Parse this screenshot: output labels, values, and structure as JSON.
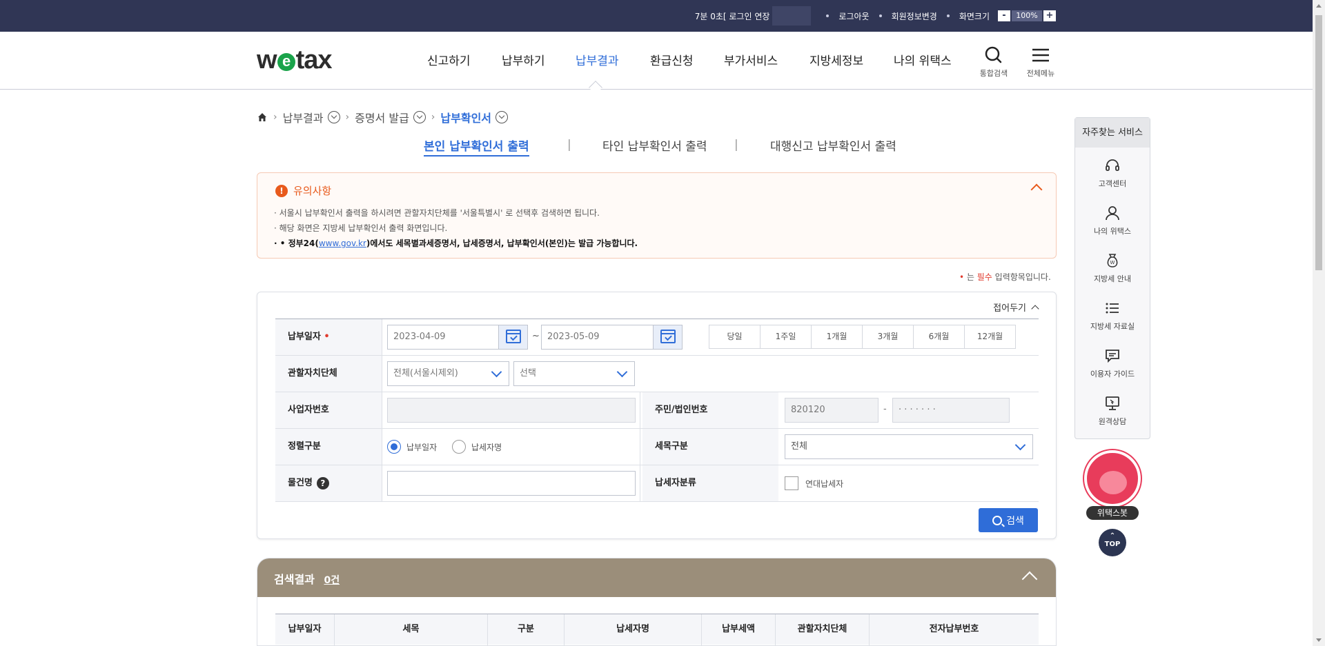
{
  "topbar": {
    "session_text": "7분 0초[ 로그인 연장",
    "logout": "로그아웃",
    "member_edit": "회원정보변경",
    "screen_size": "화면크기",
    "zoom_minus": "-",
    "zoom_value": "100%",
    "zoom_plus": "+"
  },
  "header": {
    "logo_w": "w",
    "logo_e": "e",
    "logo_tax": "tax",
    "nav": [
      "신고하기",
      "납부하기",
      "납부결과",
      "환급신청",
      "부가서비스",
      "지방세정보",
      "나의 위택스"
    ],
    "active_nav": "납부결과",
    "search_label": "통합검색",
    "menu_label": "전체메뉴"
  },
  "breadcrumb": {
    "items": [
      "납부결과",
      "증명서 발급",
      "납부확인서"
    ]
  },
  "subtabs": {
    "tab1": "본인 납부확인서 출력",
    "tab2": "타인 납부확인서 출력",
    "tab3": "대행신고 납부확인서 출력",
    "divider": "|"
  },
  "notice": {
    "title": "유의사항",
    "line1": "· 서울시 납부확인서 출력을 하시려면 관할자치단체를 '서울특별시' 로 선택후 검색하면 됩니다.",
    "line2": "· 해당 화면은 지방세 납부확인서 출력 화면입니다.",
    "line3_prefix": "· • 정부24(",
    "line3_link": "www.gov.kr",
    "line3_suffix": ")에서도 세목별과세증명서, 납세증명서, 납부확인서(본인)는 발급 가능합니다."
  },
  "required_note": {
    "bullet": "•",
    "prefix": " 는 ",
    "red": "필수",
    "suffix": " 입력항목입니다."
  },
  "form": {
    "fold_label": "접어두기",
    "pay_date_label": "납부일자",
    "req_mark": " •",
    "date_from": "2023-04-09",
    "date_sep": "~",
    "date_to": "2023-05-09",
    "periods": [
      "당일",
      "1주일",
      "1개월",
      "3개월",
      "6개월",
      "12개월"
    ],
    "jurisdiction_label": "관할자치단체",
    "jurisdiction_sel1": "전체(서울시제외)",
    "jurisdiction_sel2": "선택",
    "biz_no_label": "사업자번호",
    "biz_no_value": "",
    "resident_label": "주민/법인번호",
    "resident_front": "820120",
    "resident_dash": "-",
    "resident_back": "· · · · · · ·",
    "sort_label": "정렬구분",
    "sort_opt1": "납부일자",
    "sort_opt2": "납세자명",
    "tax_item_label": "세목구분",
    "tax_item_value": "전체",
    "object_label": "물건명",
    "help": "?",
    "object_value": "",
    "taxpayer_type_label": "납세자분류",
    "taxpayer_type_opt": "연대납세자",
    "search_button": "검색"
  },
  "results": {
    "title": "검색결과",
    "count": "0건",
    "columns": [
      "납부일자",
      "세목",
      "구분",
      "납세자명",
      "납부세액",
      "관할자치단체",
      "전자납부번호"
    ]
  },
  "quick": {
    "title": "자주찾는 서비스",
    "items": [
      "고객센터",
      "나의 위택스",
      "지방세 안내",
      "지방세 자료실",
      "이용자 가이드",
      "원격상담"
    ]
  },
  "bot_label": "위택스봇",
  "top_button": "TOP",
  "colors": {
    "topbar_bg": "#303655",
    "accent": "#2f6dd8",
    "notice": "#e85a1c",
    "results_header": "#9b8e7a"
  }
}
